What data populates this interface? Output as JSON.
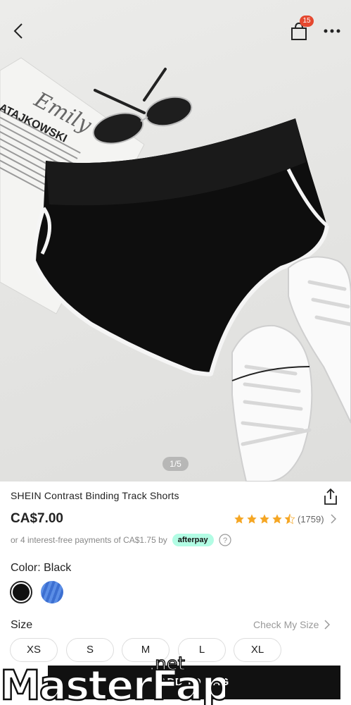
{
  "header": {
    "bag_count": "15"
  },
  "hero": {
    "page_indicator": "1/5",
    "magazine_text_1": "Emily",
    "magazine_text_2": "ATAJKOWSKI"
  },
  "product": {
    "title": "SHEIN Contrast Binding Track Shorts",
    "price": "CA$7.00",
    "rating_value": 4.5,
    "rating_count": "(1759)",
    "afterpay_text": "or 4 interest-free payments of CA$1.75 by",
    "afterpay_badge": "afterpay"
  },
  "color": {
    "label": "Color: Black",
    "options": [
      "black",
      "blue"
    ]
  },
  "size": {
    "label": "Size",
    "check_label": "Check My Size",
    "options": [
      "XS",
      "S",
      "M",
      "L",
      "XL"
    ]
  },
  "cta": {
    "add_to_bag": "ADD TO BAG"
  },
  "watermark": {
    "text_main": "MasterFap",
    "text_sub": ".net"
  },
  "icons": [
    "back-icon",
    "bag-icon",
    "more-icon",
    "share-icon",
    "star-icon",
    "chevron-right-icon",
    "help-icon"
  ],
  "colors": {
    "badge": "#e5482f",
    "afterpay": "#b2fce4",
    "star": "#f5a623",
    "button": "#111111"
  }
}
